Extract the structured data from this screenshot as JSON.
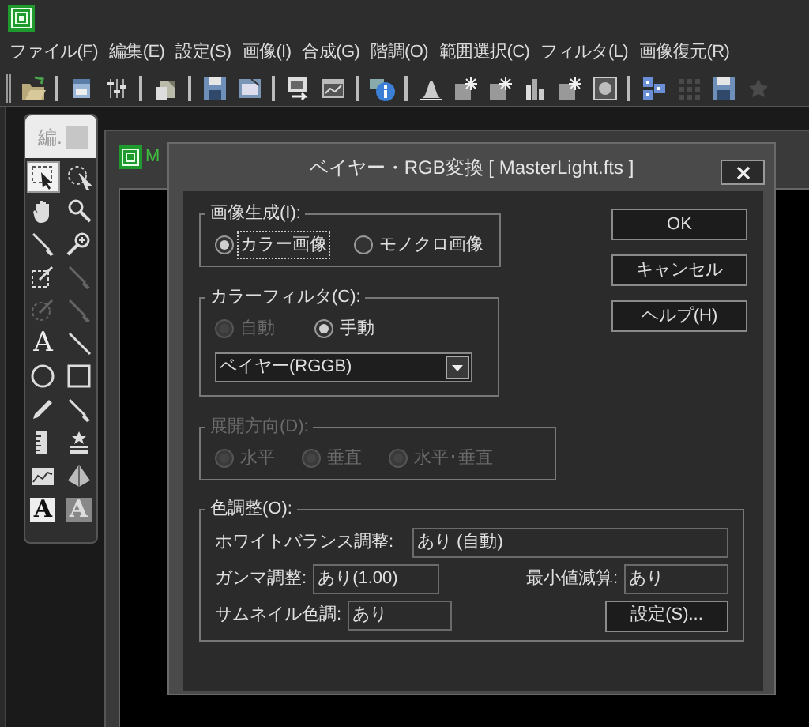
{
  "app": {
    "menu": [
      {
        "label": "ファイル(F)"
      },
      {
        "label": "編集(E)"
      },
      {
        "label": "設定(S)"
      },
      {
        "label": "画像(I)"
      },
      {
        "label": "合成(G)"
      },
      {
        "label": "階調(O)"
      },
      {
        "label": "範囲選択(C)"
      },
      {
        "label": "フィルタ(L)"
      },
      {
        "label": "画像復元(R)"
      }
    ],
    "toolbar": [
      {
        "kind": "folder",
        "disabled": false
      },
      {
        "kind": "separator"
      },
      {
        "kind": "window",
        "disabled": false
      },
      {
        "kind": "sliders",
        "disabled": false
      },
      {
        "kind": "separator"
      },
      {
        "kind": "pages",
        "disabled": false
      },
      {
        "kind": "separator"
      },
      {
        "kind": "floppy",
        "disabled": false
      },
      {
        "kind": "screen",
        "disabled": false
      },
      {
        "kind": "separator"
      },
      {
        "kind": "window-arrow",
        "disabled": false
      },
      {
        "kind": "chart-window",
        "disabled": false
      },
      {
        "kind": "separator"
      },
      {
        "kind": "info",
        "disabled": false
      },
      {
        "kind": "separator"
      },
      {
        "kind": "histogram",
        "disabled": false
      },
      {
        "kind": "sparkle",
        "disabled": false
      },
      {
        "kind": "sparkle",
        "disabled": false
      },
      {
        "kind": "bars",
        "disabled": false
      },
      {
        "kind": "sparkle",
        "disabled": false
      },
      {
        "kind": "glow",
        "disabled": false
      },
      {
        "kind": "separator"
      },
      {
        "kind": "squares",
        "disabled": false
      },
      {
        "kind": "grid",
        "disabled": true
      },
      {
        "kind": "floppy",
        "disabled": false
      },
      {
        "kind": "star",
        "disabled": true
      }
    ]
  },
  "tool_palette": {
    "title": "編.",
    "tools": [
      {
        "kind": "select-rect",
        "selected": true,
        "disabled": false
      },
      {
        "kind": "select-lasso",
        "selected": false,
        "disabled": false
      },
      {
        "kind": "hand",
        "selected": false,
        "disabled": false
      },
      {
        "kind": "magnifier",
        "selected": false,
        "disabled": false
      },
      {
        "kind": "dropper",
        "selected": false,
        "disabled": false
      },
      {
        "kind": "zoom-plus",
        "selected": false,
        "disabled": false
      },
      {
        "kind": "rect-pen",
        "selected": false,
        "disabled": false
      },
      {
        "kind": "dropper",
        "selected": false,
        "disabled": true
      },
      {
        "kind": "circle-pen",
        "selected": false,
        "disabled": true
      },
      {
        "kind": "dropper",
        "selected": false,
        "disabled": true
      },
      {
        "kind": "text",
        "glyph": "A",
        "selected": false,
        "disabled": false
      },
      {
        "kind": "line",
        "selected": false,
        "disabled": false
      },
      {
        "kind": "circle",
        "selected": false,
        "disabled": false
      },
      {
        "kind": "square",
        "selected": false,
        "disabled": false
      },
      {
        "kind": "pencil",
        "selected": false,
        "disabled": false
      },
      {
        "kind": "dropper",
        "selected": false,
        "disabled": false
      },
      {
        "kind": "ruler",
        "selected": false,
        "disabled": false
      },
      {
        "kind": "stamp",
        "selected": false,
        "disabled": false
      },
      {
        "kind": "line-chart",
        "selected": false,
        "disabled": false
      },
      {
        "kind": "pyramid",
        "selected": false,
        "disabled": false
      },
      {
        "kind": "text-box",
        "glyph": "A",
        "selected": false,
        "disabled": false
      },
      {
        "kind": "text-box-dim",
        "glyph": "A",
        "selected": false,
        "disabled": false
      }
    ]
  },
  "document_window": {
    "title": "M"
  },
  "dialog": {
    "title": "ベイヤー・RGB変換 [ MasterLight.fts ]",
    "image_generation": {
      "label": "画像生成(I):",
      "options": [
        {
          "label": "カラー画像",
          "selected": true,
          "focused": true
        },
        {
          "label": "モノクロ画像",
          "selected": false,
          "focused": false
        }
      ]
    },
    "color_filter": {
      "label": "カラーフィルタ(C):",
      "options": [
        {
          "label": "自動",
          "selected": false,
          "disabled": true
        },
        {
          "label": "手動",
          "selected": true,
          "disabled": false
        }
      ],
      "dropdown": {
        "value": "ベイヤー(RGGB)"
      }
    },
    "expansion_direction": {
      "label": "展開方向(D):",
      "disabled": true,
      "options": [
        {
          "label": "水平",
          "selected": false
        },
        {
          "label": "垂直",
          "selected": false
        },
        {
          "label": "水平･垂直",
          "selected": false
        }
      ]
    },
    "color_adjustment": {
      "label": "色調整(O):",
      "rows": [
        [
          {
            "label": "ホワイトバランス調整:",
            "value": "あり (自動)"
          }
        ],
        [
          {
            "label": "ガンマ調整:",
            "value": "あり(1.00)"
          },
          {
            "label": "最小値減算:",
            "value": "あり"
          }
        ],
        [
          {
            "label": "サムネイル色調:",
            "value": "あり"
          }
        ]
      ],
      "settings_button": "設定(S)..."
    },
    "buttons": [
      {
        "label": "OK"
      },
      {
        "label": "キャンセル"
      },
      {
        "label": "ヘルプ(H)"
      }
    ]
  }
}
